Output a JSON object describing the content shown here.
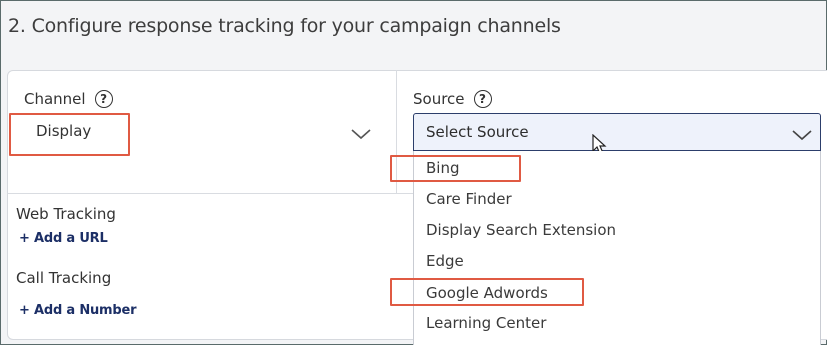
{
  "step": {
    "title": "2.  Configure response tracking for your campaign channels"
  },
  "channel": {
    "label": "Channel",
    "help_icon": "question-circle-icon",
    "value": "Display",
    "chevron_icon": "chevron-down-icon"
  },
  "source": {
    "label": "Source",
    "help_icon": "question-circle-icon",
    "placeholder": "Select Source",
    "chevron_icon": "chevron-down-icon",
    "options": [
      "Bing",
      "Care Finder",
      "Display Search Extension",
      "Edge",
      "Google Adwords",
      "Learning Center"
    ]
  },
  "web_tracking": {
    "title": "Web Tracking",
    "add_label": "+ Add a URL"
  },
  "call_tracking": {
    "title": "Call Tracking",
    "add_label": "+ Add a Number"
  },
  "colors": {
    "highlight": "#e05a43",
    "link": "#1c2f66",
    "select_border": "#2c3e6b",
    "select_bg": "#eef2fb"
  }
}
